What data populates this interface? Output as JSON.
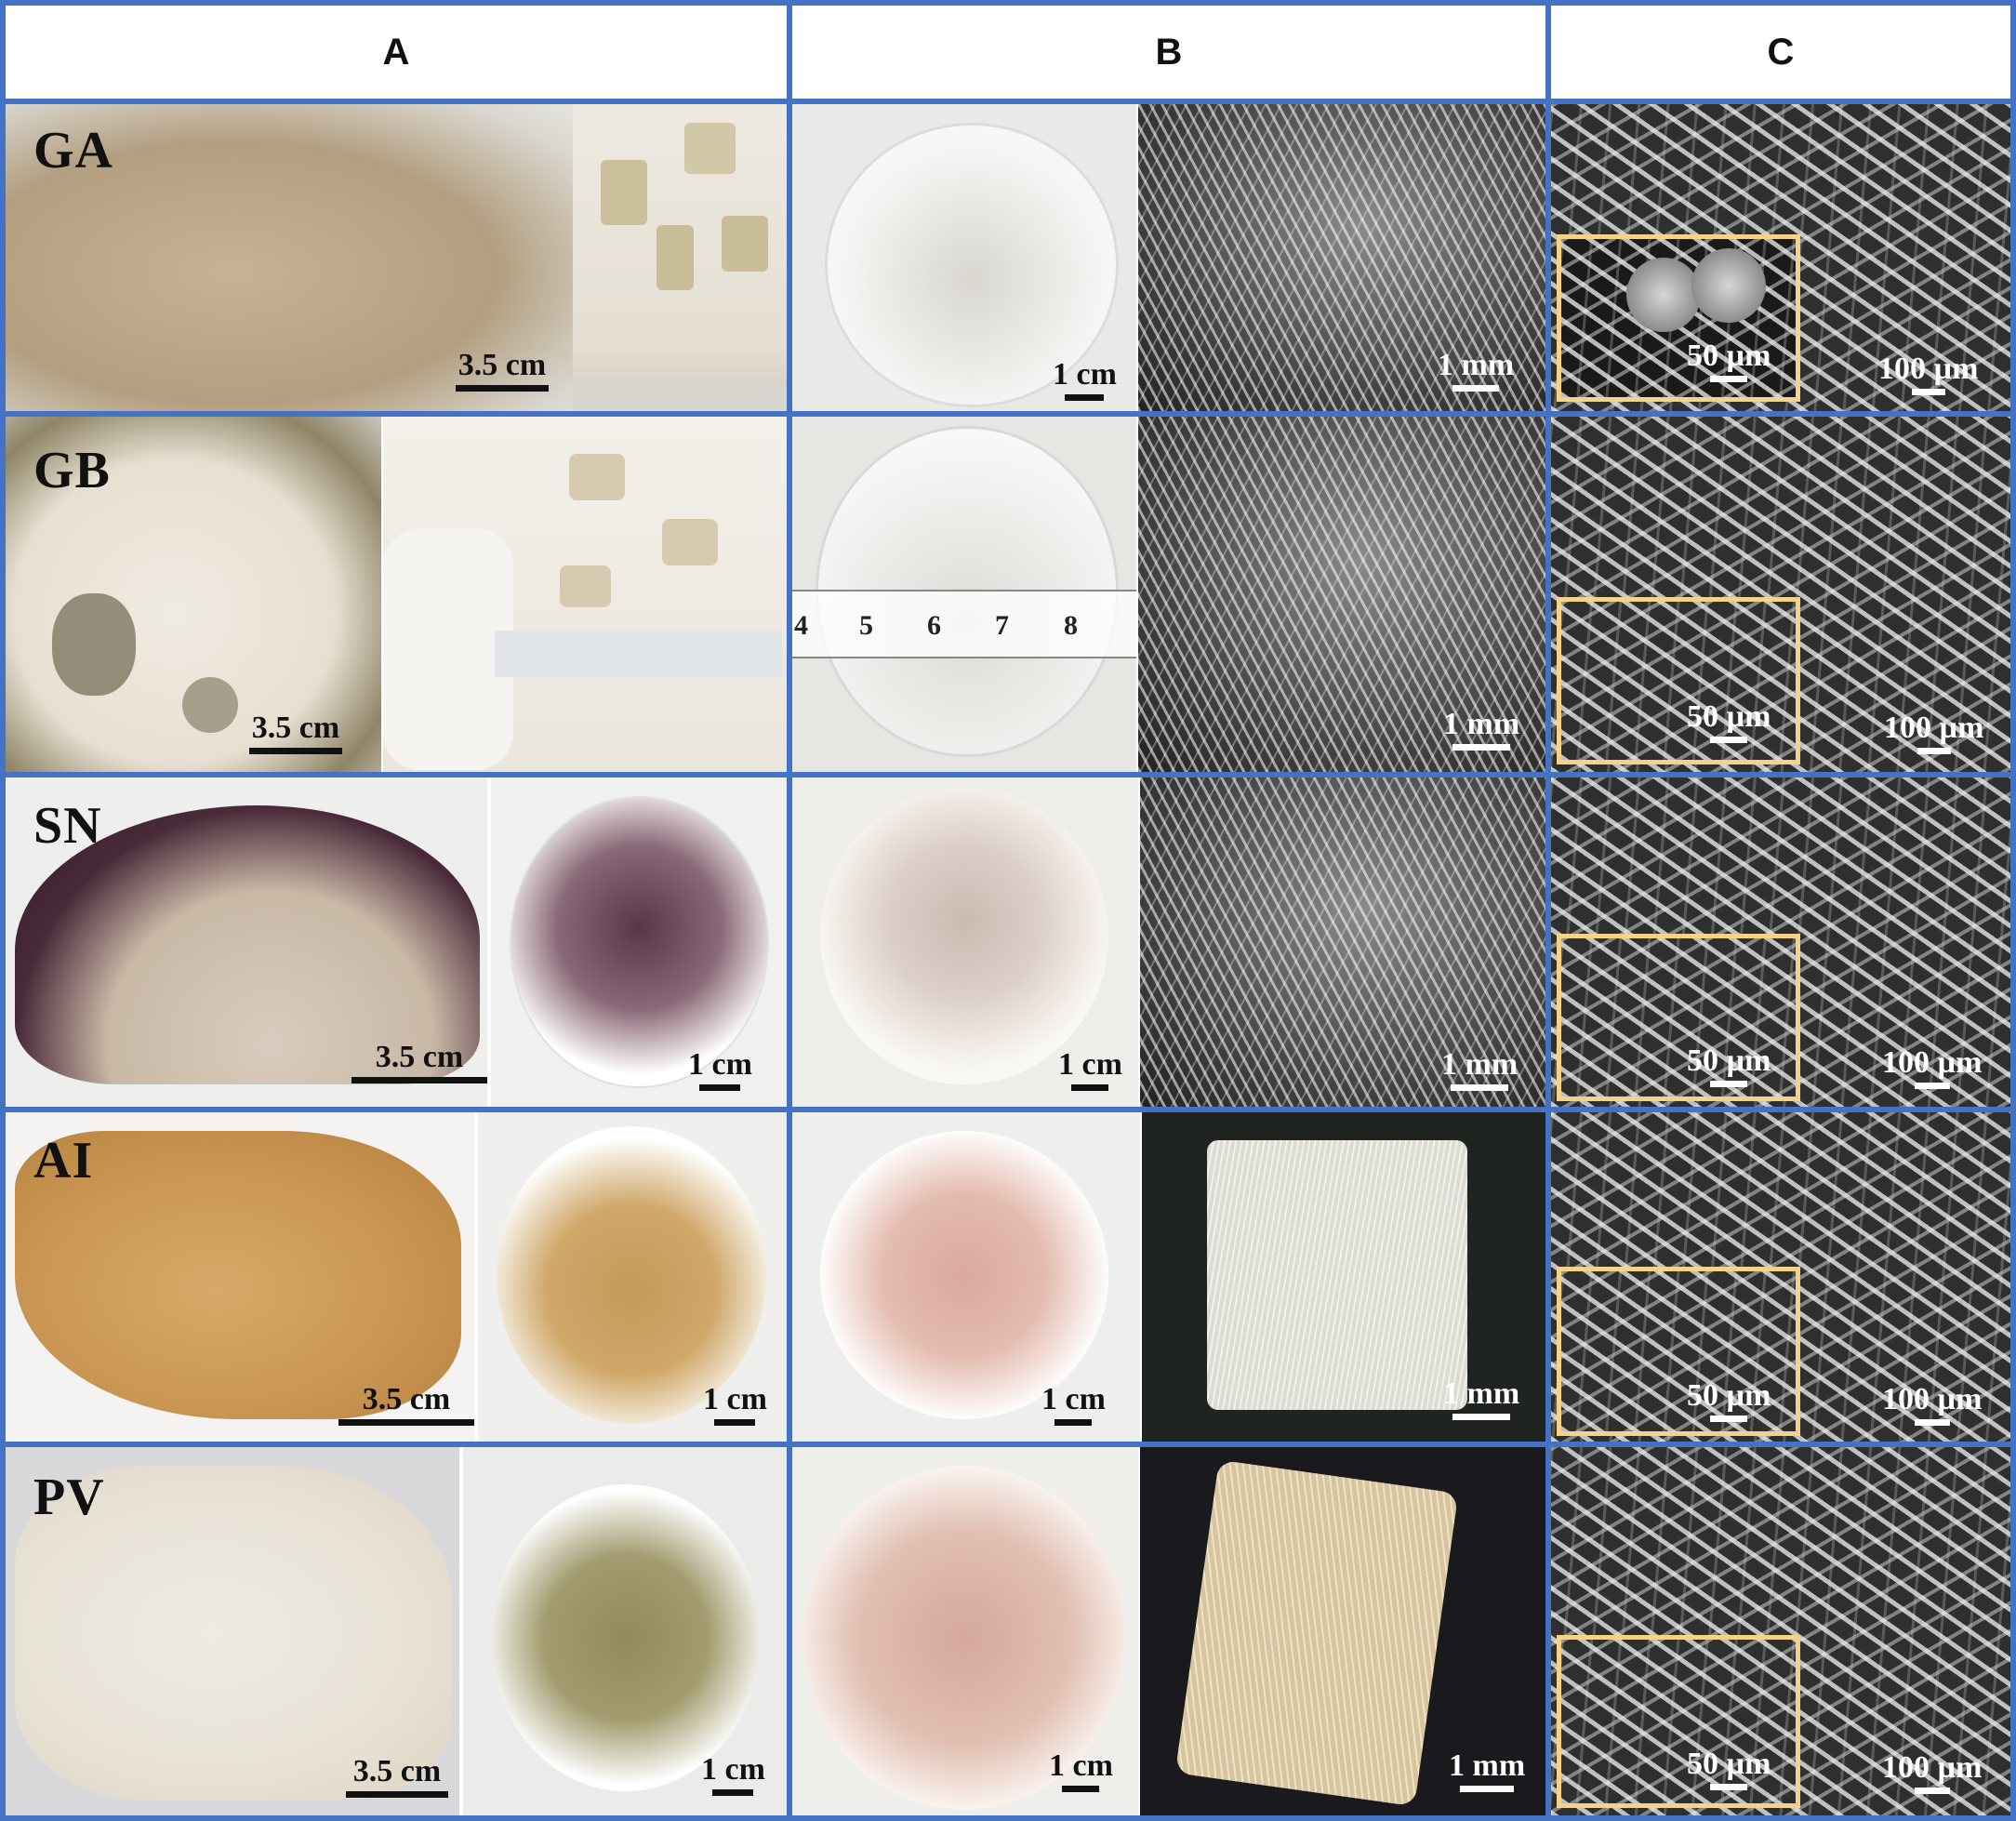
{
  "columns": [
    {
      "label": "A"
    },
    {
      "label": "B"
    },
    {
      "label": "C"
    }
  ],
  "rows": [
    {
      "id": "GA",
      "label": "GA",
      "scale_a_main": "3.5 cm",
      "scale_b_main": "1 cm",
      "scale_b_micro": "1 mm",
      "scale_c_inset": "50 µm",
      "scale_c_main": "100 µm"
    },
    {
      "id": "GB",
      "label": "GB",
      "scale_a_main": "3.5 cm",
      "scale_b_micro": "1 mm",
      "scale_c_inset": "50 µm",
      "scale_c_main": "100 µm",
      "ruler_numbers": [
        "4",
        "5",
        "6",
        "7",
        "8"
      ]
    },
    {
      "id": "SN",
      "label": "SN",
      "scale_a_main": "3.5 cm",
      "scale_a_bowl": "1 cm",
      "scale_b_main": "1 cm",
      "scale_b_micro": "1 mm",
      "scale_c_inset": "50 µm",
      "scale_c_main": "100 µm"
    },
    {
      "id": "AI",
      "label": "AI",
      "scale_a_main": "3.5 cm",
      "scale_a_bowl": "1 cm",
      "scale_b_main": "1 cm",
      "scale_b_micro": "1 mm",
      "scale_c_inset": "50 µm",
      "scale_c_main": "100 µm"
    },
    {
      "id": "PV",
      "label": "PV",
      "scale_a_main": "3.5 cm",
      "scale_a_bowl": "1 cm",
      "scale_b_main": "1 cm",
      "scale_b_micro": "1 mm",
      "scale_c_inset": "50 µm",
      "scale_c_main": "100 µm"
    }
  ],
  "colors": {
    "grid_border": "#4472c4",
    "inset_border": "#f5d18a"
  }
}
